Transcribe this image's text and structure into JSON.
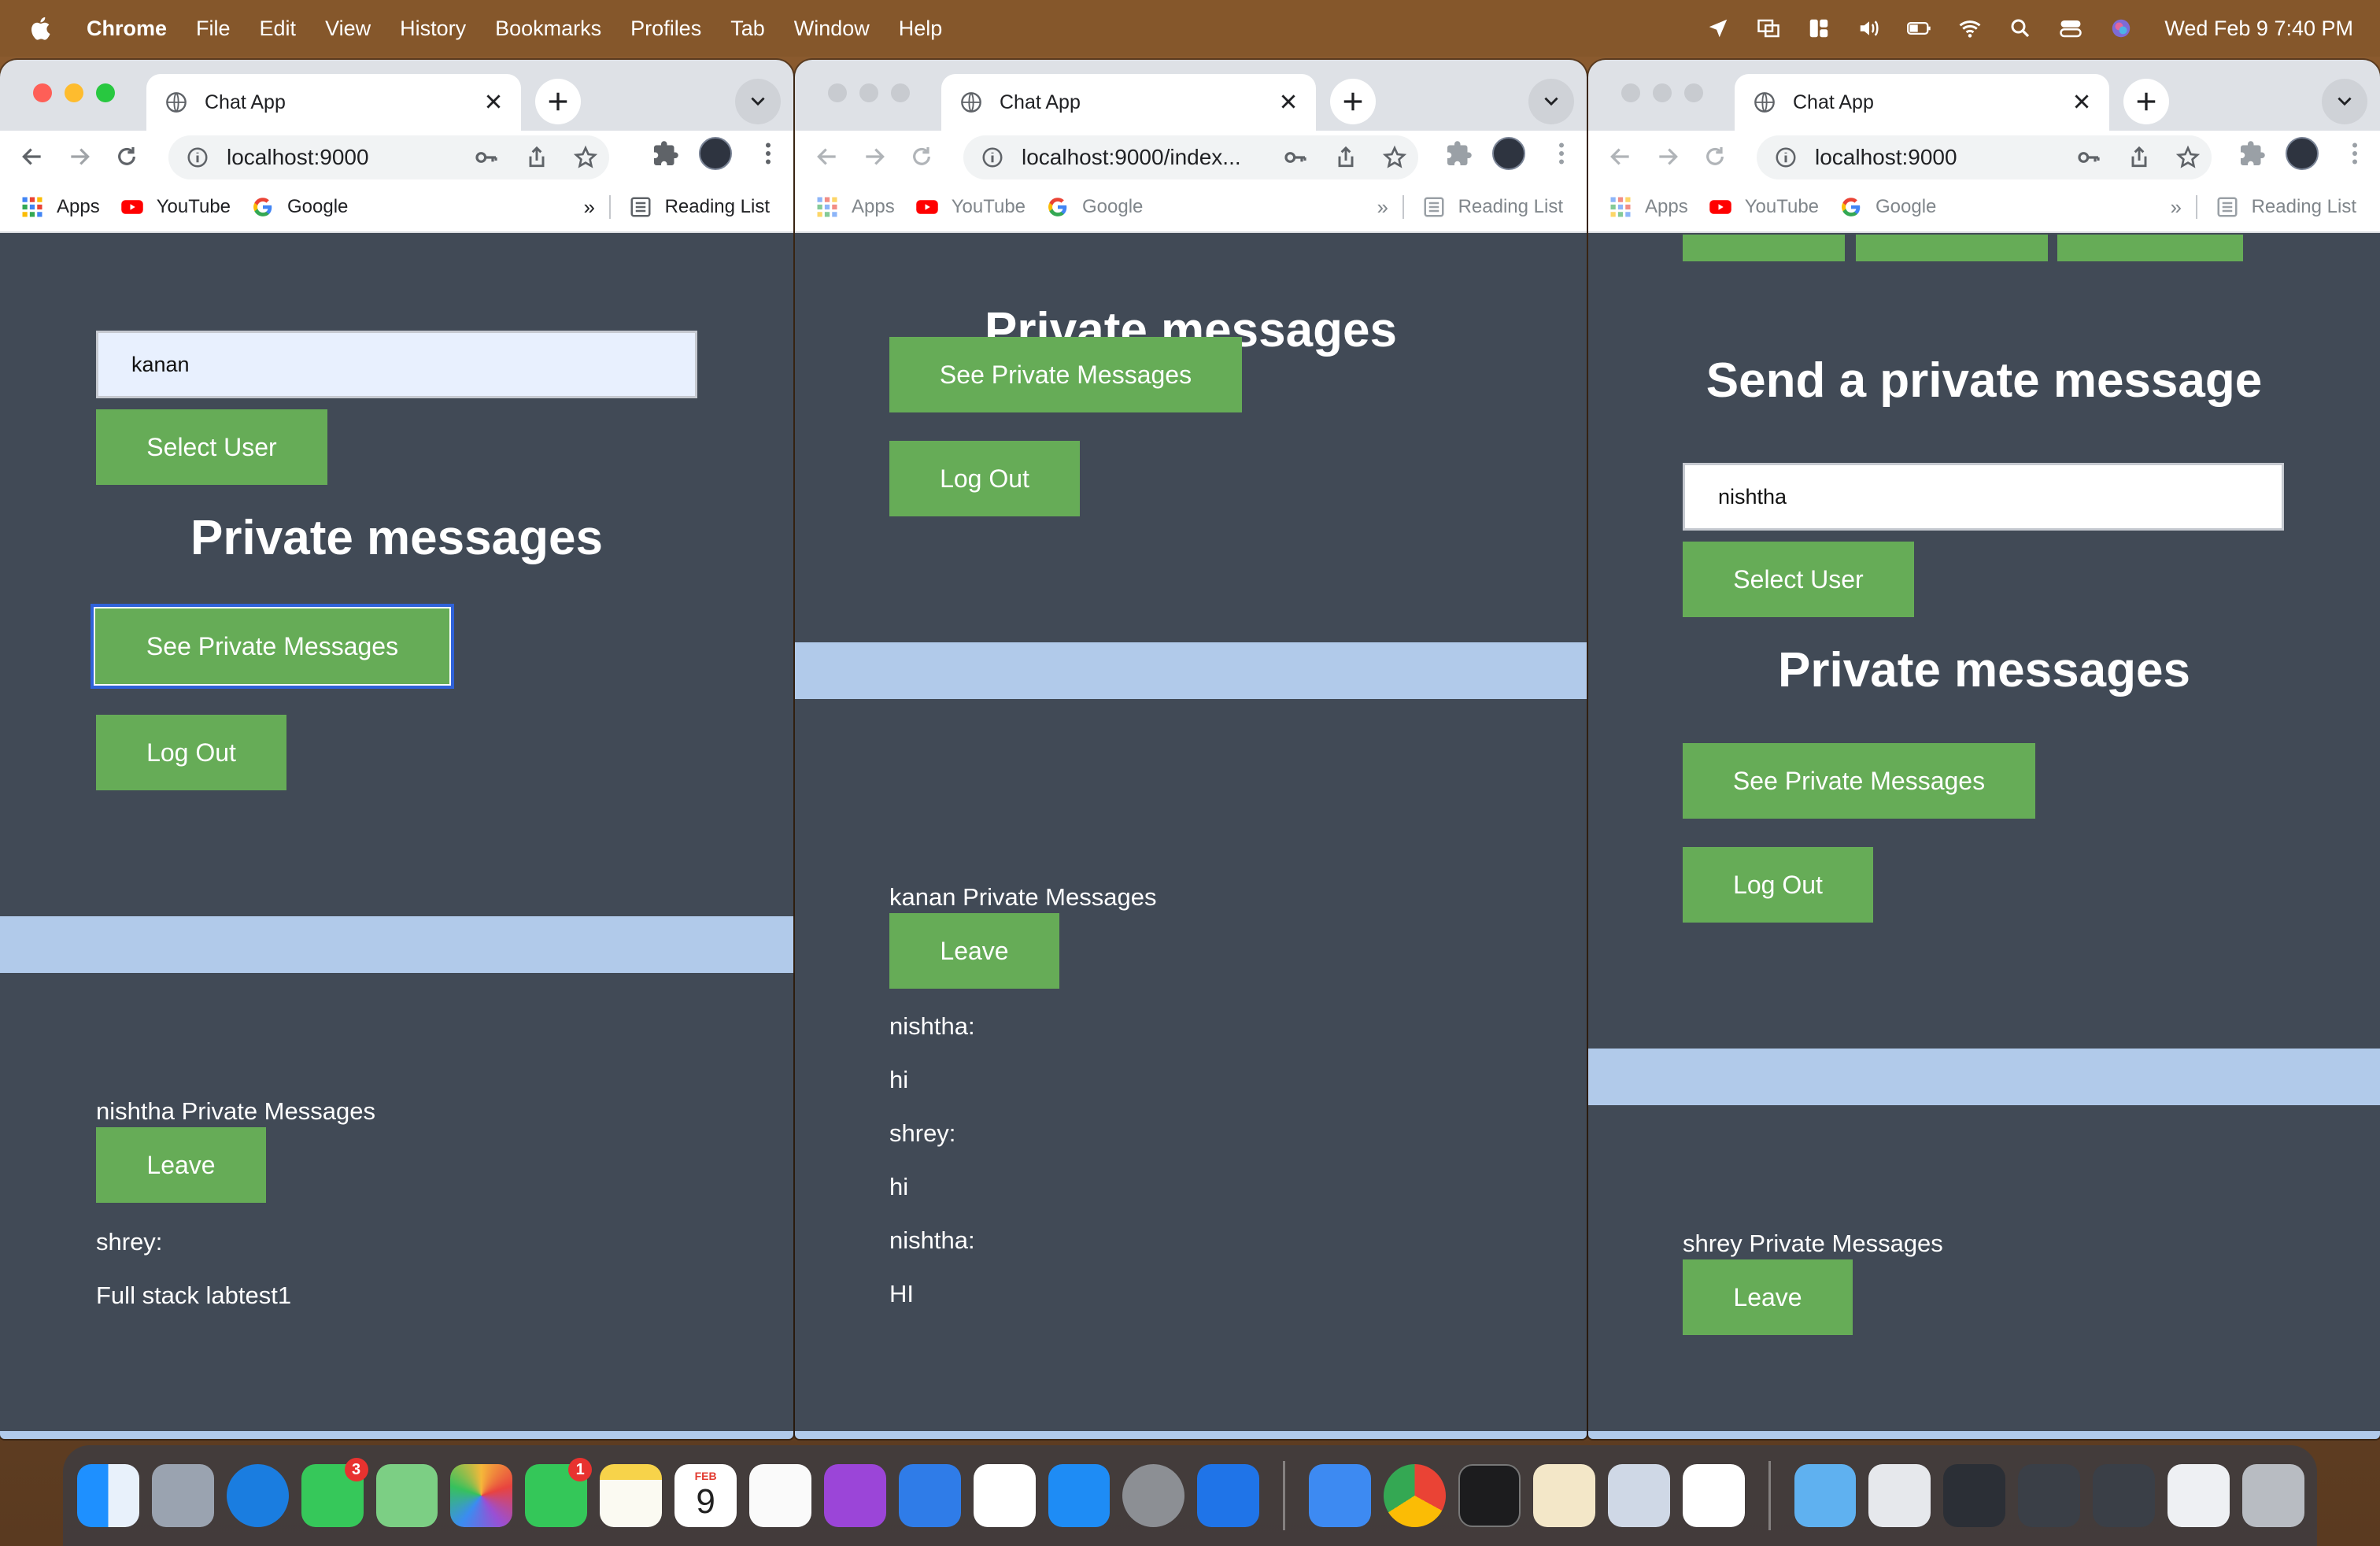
{
  "menubar": {
    "app_name": "Chrome",
    "items": [
      "File",
      "Edit",
      "View",
      "History",
      "Bookmarks",
      "Profiles",
      "Tab",
      "Window",
      "Help"
    ],
    "clock": "Wed Feb 9  7:40 PM"
  },
  "browser": {
    "tab_title": "Chat App",
    "bookmarks": {
      "apps": "Apps",
      "youtube": "YouTube",
      "google": "Google",
      "more": "»",
      "reading_list": "Reading List"
    }
  },
  "windows": [
    {
      "url": "localhost:9000",
      "user_input_value": "kanan",
      "select_user_label": "Select User",
      "private_heading": "Private messages",
      "see_private_label": "See Private Messages",
      "logout_label": "Log Out",
      "conversation_title": "nishtha Private Messages",
      "leave_label": "Leave",
      "messages": [
        "shrey:",
        "Full stack labtest1"
      ]
    },
    {
      "url": "localhost:9000/index...",
      "private_heading": "Private messages",
      "see_private_label": "See Private Messages",
      "logout_label": "Log Out",
      "conversation_title": "kanan Private Messages",
      "leave_label": "Leave",
      "messages": [
        "nishtha:",
        "hi",
        "shrey:",
        "hi",
        "nishtha:",
        "HI"
      ]
    },
    {
      "url": "localhost:9000",
      "send_heading": "Send a private message",
      "user_input_value": "nishtha",
      "select_user_label": "Select User",
      "private_heading": "Private messages",
      "see_private_label": "See Private Messages",
      "logout_label": "Log Out",
      "conversation_title": "shrey Private Messages",
      "leave_label": "Leave"
    }
  ],
  "dock": {
    "messages_badge": "3",
    "facetime_badge": "1",
    "calendar_month": "FEB",
    "calendar_day": "9"
  },
  "colors": {
    "page_bg": "#414a56",
    "button_green": "#66ac57",
    "divider_band": "#b1caea",
    "menubar": "#85572b"
  }
}
